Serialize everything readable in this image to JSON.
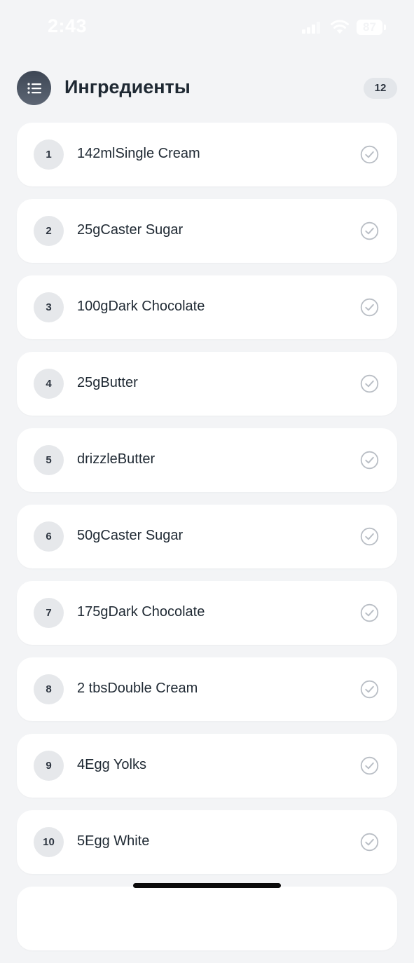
{
  "status_bar": {
    "time": "2:43",
    "battery": "87",
    "icons": [
      "signal-icon",
      "wifi-icon",
      "battery-icon"
    ]
  },
  "header": {
    "icon": "list-icon",
    "title": "Ингредиенты",
    "count": "12"
  },
  "ingredients": [
    {
      "number": "1",
      "text": "142mlSingle Cream"
    },
    {
      "number": "2",
      "text": "25gCaster Sugar"
    },
    {
      "number": "3",
      "text": "100gDark Chocolate"
    },
    {
      "number": "4",
      "text": "25gButter"
    },
    {
      "number": "5",
      "text": "drizzleButter"
    },
    {
      "number": "6",
      "text": "50gCaster Sugar"
    },
    {
      "number": "7",
      "text": "175gDark Chocolate"
    },
    {
      "number": "8",
      "text": "2 tbsDouble Cream"
    },
    {
      "number": "9",
      "text": "4Egg Yolks"
    },
    {
      "number": "10",
      "text": "5Egg White"
    },
    {
      "number": "",
      "text": ""
    }
  ],
  "colors": {
    "background": "#f3f4f6",
    "card": "#ffffff",
    "number_circle": "#e6e8eb",
    "check": "#b9bec5",
    "header_icon": "#4a5260"
  }
}
